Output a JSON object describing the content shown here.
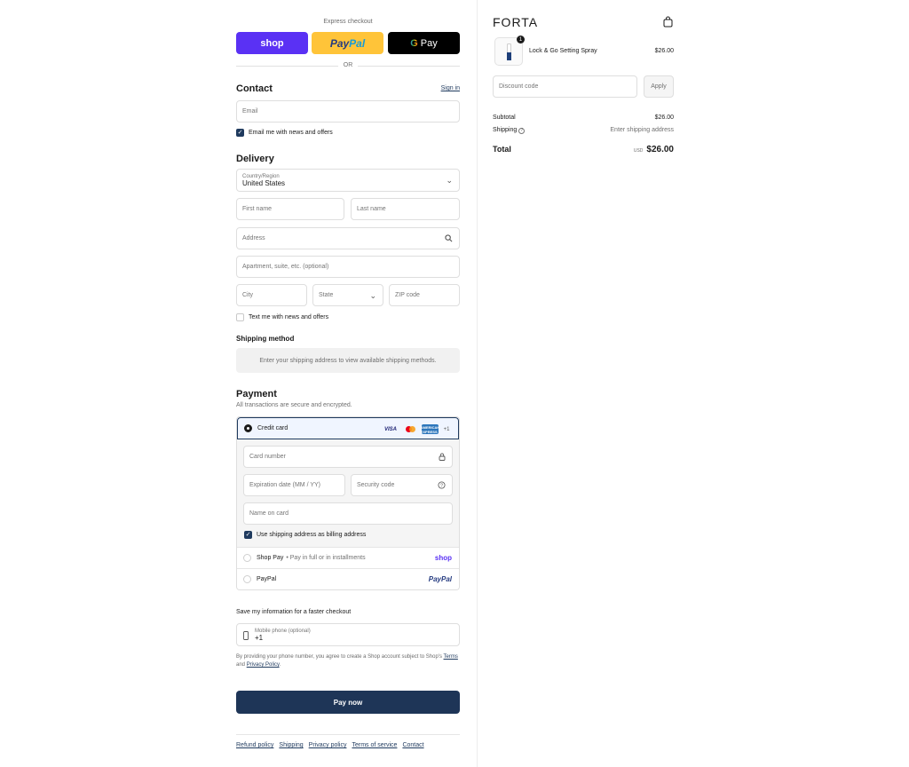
{
  "express": {
    "title": "Express checkout",
    "shop_label": "shop",
    "paypal_label_1": "Pay",
    "paypal_label_2": "Pal",
    "gpay_g": "G",
    "gpay_label": "Pay",
    "or": "OR"
  },
  "contact": {
    "heading": "Contact",
    "sign_in": "Sign in",
    "email_placeholder": "Email",
    "news_label": "Email me with news and offers",
    "news_checked": true
  },
  "delivery": {
    "heading": "Delivery",
    "country_label": "Country/Region",
    "country_value": "United States",
    "first_name": "First name",
    "last_name": "Last name",
    "address": "Address",
    "apartment": "Apartment, suite, etc. (optional)",
    "city": "City",
    "state": "State",
    "zip": "ZIP code",
    "text_label": "Text me with news and offers",
    "text_checked": false
  },
  "shipping_method": {
    "heading": "Shipping method",
    "note": "Enter your shipping address to view available shipping methods."
  },
  "payment": {
    "heading": "Payment",
    "subheading": "All transactions are secure and encrypted.",
    "credit_card": "Credit card",
    "card_visa": "VISA",
    "card_amex": "AMERICAN EXPRESS",
    "card_more": "+1",
    "card_number": "Card number",
    "expiration": "Expiration date (MM / YY)",
    "security": "Security code",
    "name_on_card": "Name on card",
    "billing_label": "Use shipping address as billing address",
    "billing_checked": true,
    "shop_pay": "Shop Pay",
    "shop_pay_sub": "• Pay in full or in installments",
    "shop_brand": "shop",
    "paypal": "PayPal",
    "paypal_brand": "PayPal"
  },
  "save_info": {
    "heading": "Save my information for a faster checkout",
    "phone_label": "Mobile phone (optional)",
    "phone_value": "+1",
    "disclaimer_pre": "By providing your phone number, you agree to create a Shop account subject to Shop's ",
    "terms": "Terms",
    "and": " and ",
    "privacy": "Privacy Policy",
    "period": "."
  },
  "pay_now": "Pay now",
  "footer": [
    "Refund policy",
    "Shipping",
    "Privacy policy",
    "Terms of service",
    "Contact"
  ],
  "summary": {
    "logo": "FORTA",
    "item_qty": "1",
    "item_name": "Lock & Go Setting Spray",
    "item_price": "$26.00",
    "discount_placeholder": "Discount code",
    "apply": "Apply",
    "subtotal_label": "Subtotal",
    "subtotal_value": "$26.00",
    "shipping_label": "Shipping",
    "shipping_value": "Enter shipping address",
    "total_label": "Total",
    "currency": "USD",
    "total_value": "$26.00"
  },
  "colors": {
    "primary": "#1e3557",
    "shop_purple": "#5a31f4",
    "paypal_yellow": "#ffc439"
  }
}
